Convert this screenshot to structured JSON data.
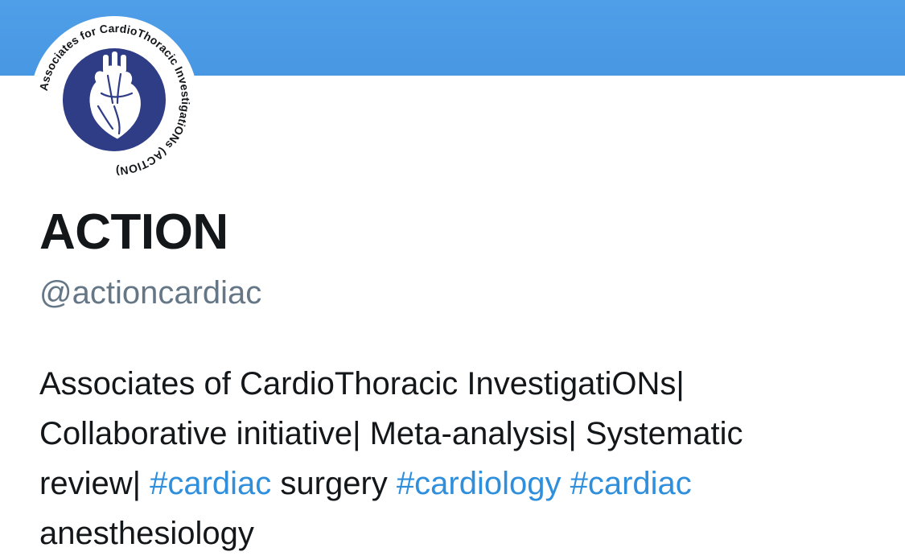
{
  "profile": {
    "display_name": "ACTION",
    "handle": "@actioncardiac",
    "avatar": {
      "icon": "heart-logo-icon",
      "ring_text": "Associates for CardioThoracic InvestigatiONs (ACTION)",
      "circle_color": "#2e3d86"
    },
    "banner_color": "#4897e3"
  },
  "bio": {
    "line1": "Associates of CardioThoracic InvestigatiONs|",
    "line2": "Collaborative initiative| Meta-analysis| Systematic",
    "line3_pre": "review| ",
    "hashtag1": "#cardiac",
    "line3_mid": " surgery ",
    "hashtag2": "#cardiology",
    "line3_space": " ",
    "hashtag3": "#cardiac",
    "line4": "anesthesiology"
  },
  "colors": {
    "hashtag": "#2f8fdc",
    "handle": "#657786",
    "text": "#14171a"
  }
}
